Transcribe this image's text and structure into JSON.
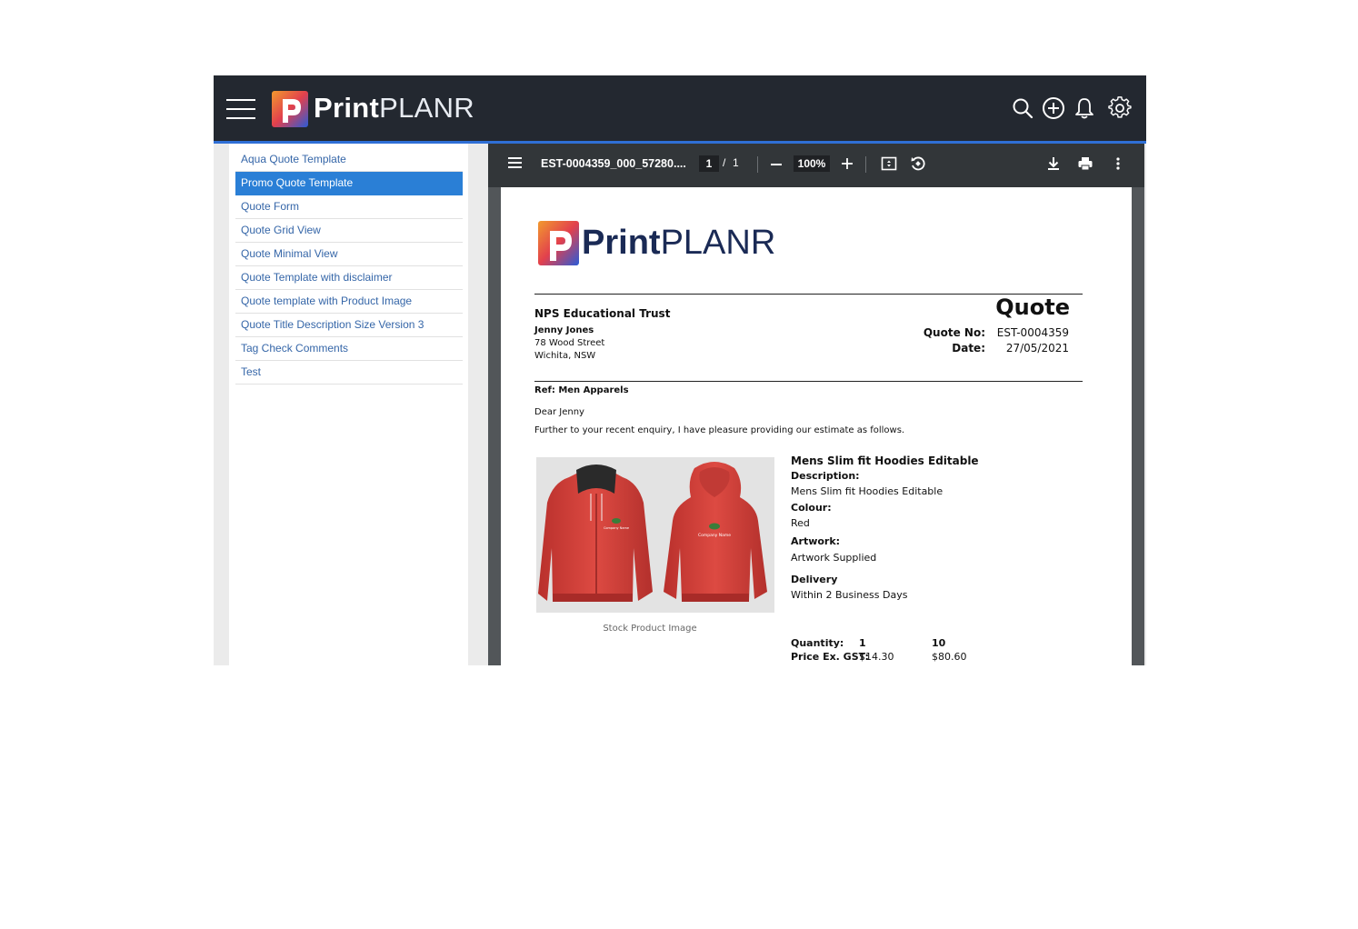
{
  "app": {
    "brand_bold": "Print",
    "brand_light": "PLANR",
    "logo_letter": "P",
    "header_icons": [
      "search-icon",
      "add-circle-icon",
      "bell-icon",
      "gear-icon"
    ]
  },
  "sidebar": {
    "active_index": 1,
    "items": [
      "Aqua Quote Template",
      "Promo Quote Template",
      "Quote Form",
      "Quote Grid View",
      "Quote Minimal View",
      "Quote Template with disclaimer",
      "Quote template with Product Image",
      "Quote Title Description Size Version 3",
      "Tag Check Comments",
      "Test"
    ]
  },
  "pdf_toolbar": {
    "filename": "EST-0004359_000_57280....",
    "current_page": "1",
    "page_separator": "/",
    "total_pages": "1",
    "zoom": "100%",
    "icons": [
      "menu-icon",
      "zoom-out-icon",
      "zoom-in-icon",
      "fit-page-icon",
      "rotate-icon",
      "download-icon",
      "print-icon",
      "more-vert-icon"
    ]
  },
  "document": {
    "brand_bold": "Print",
    "brand_light": "PLANR",
    "title": "Quote",
    "client": {
      "organisation": "NPS Educational Trust",
      "contact": "Jenny Jones",
      "street": "78 Wood Street",
      "city": "Wichita, NSW"
    },
    "meta": {
      "quote_no_label": "Quote No:",
      "quote_no": "EST-0004359",
      "date_label": "Date:",
      "date": "27/05/2021"
    },
    "ref": "Ref: Men Apparels",
    "salutation": "Dear Jenny",
    "intro": "Further to your recent enquiry, I have pleasure providing our estimate as follows.",
    "image_caption": "Stock Product Image",
    "image_logo_text": "Company Name",
    "product": {
      "name": "Mens Slim fit Hoodies Editable",
      "description_label": "Description:",
      "description": "Mens Slim fit Hoodies Editable",
      "colour_label": "Colour:",
      "colour": "Red",
      "artwork_label": "Artwork:",
      "artwork": "Artwork Supplied",
      "delivery_label": "Delivery",
      "delivery": "Within 2 Business Days",
      "quantity_label": "Quantity:",
      "price_label": "Price Ex. GST:",
      "quantities": [
        "1",
        "10"
      ],
      "prices": [
        "$14.30",
        "$80.60"
      ]
    }
  },
  "colors": {
    "header_bg": "#232830",
    "accent_blue": "#2a7fd6",
    "link_blue": "#3566a8",
    "pdf_toolbar": "#323639",
    "hoodie_red": "#d9453f"
  }
}
